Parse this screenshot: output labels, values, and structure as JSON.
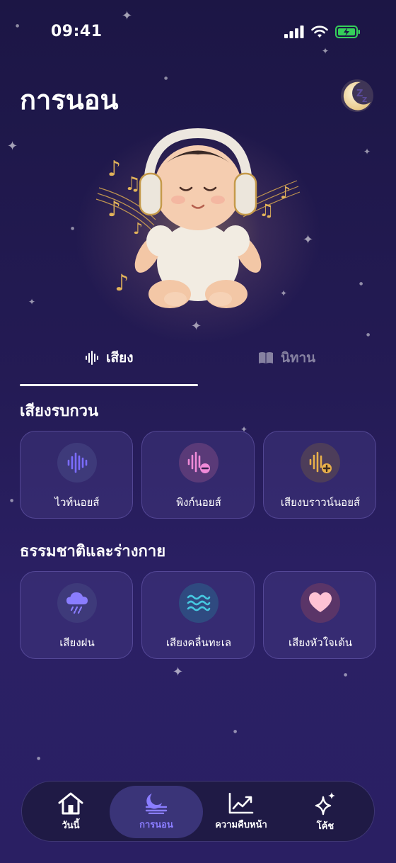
{
  "status_bar": {
    "time": "09:41"
  },
  "header": {
    "title": "การนอน",
    "moon_icon": "moon-zzz-icon"
  },
  "tabs": [
    {
      "label": "เสียง",
      "icon": "waveform-icon",
      "active": true
    },
    {
      "label": "นิทาน",
      "icon": "book-icon",
      "active": false
    }
  ],
  "sections": [
    {
      "title": "เสียงรบกวน",
      "items": [
        {
          "label": "ไวท์นอยส์",
          "icon": "waveform-icon",
          "color": "#7b6cff",
          "bg": "#3e3a7a"
        },
        {
          "label": "พิงก์นอยส์",
          "icon": "waveform-minus-icon",
          "color": "#f08ad8",
          "bg": "#5a3a78"
        },
        {
          "label": "เสียงบราวน์นอยส์",
          "icon": "waveform-plus-icon",
          "color": "#e8b04a",
          "bg": "#4d3d5a"
        }
      ]
    },
    {
      "title": "ธรรมชาติและร่างกาย",
      "items": [
        {
          "label": "เสียงฝน",
          "icon": "rain-cloud-icon",
          "color": "#8a7dff",
          "bg": "#3e3a7a"
        },
        {
          "label": "เสียงคลื่นทะเล",
          "icon": "waves-icon",
          "color": "#46c8e0",
          "bg": "#2f4a80"
        },
        {
          "label": "เสียงหัวใจเต้น",
          "icon": "heart-icon",
          "color": "#ffc2d4",
          "bg": "#5a3568"
        }
      ]
    }
  ],
  "nav": [
    {
      "label": "วันนี้",
      "icon": "home-icon",
      "active": false
    },
    {
      "label": "การนอน",
      "icon": "moon-icon",
      "active": true
    },
    {
      "label": "ความคืบหน้า",
      "icon": "chart-icon",
      "active": false
    },
    {
      "label": "โค้ช",
      "icon": "sparkles-icon",
      "active": false
    }
  ]
}
